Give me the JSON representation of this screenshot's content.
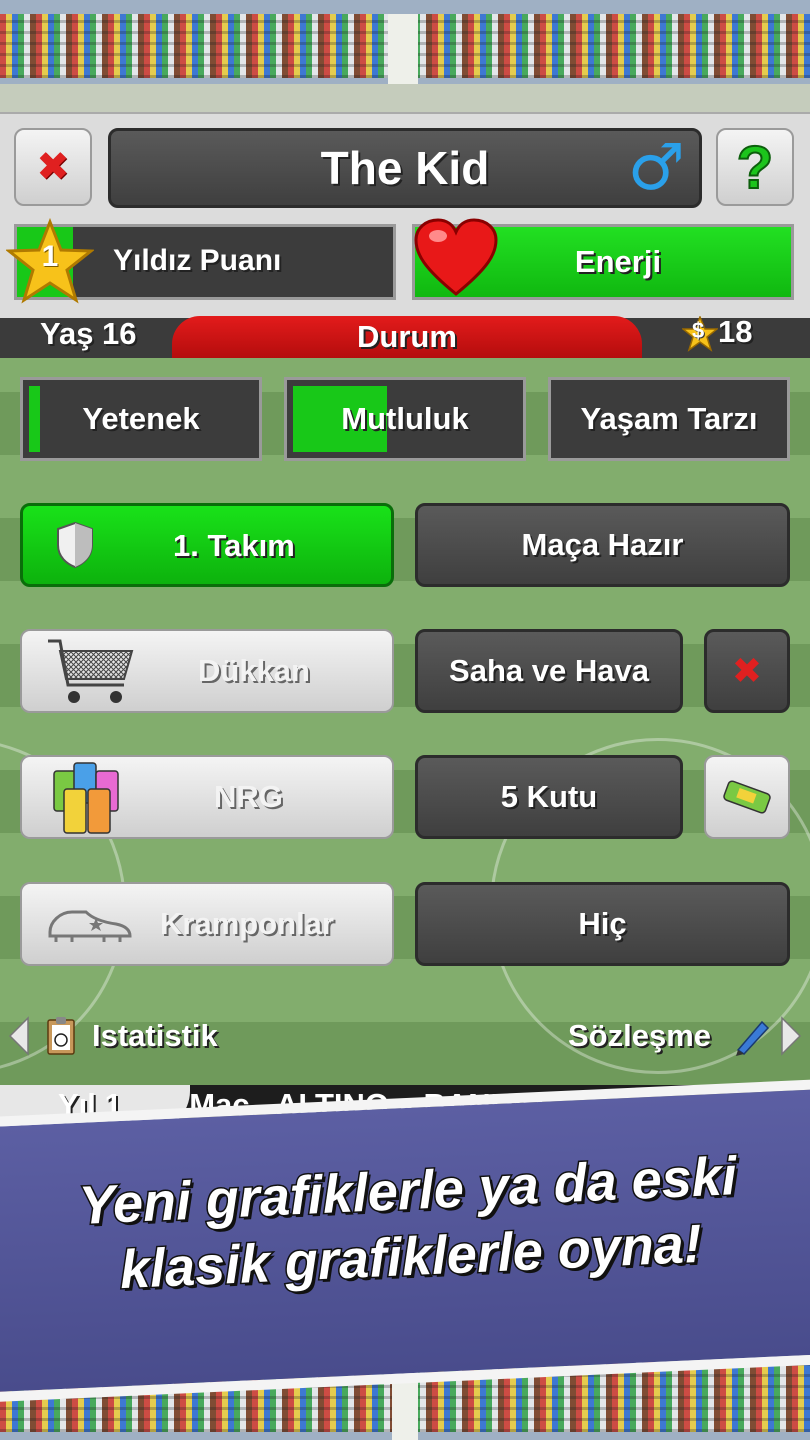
{
  "header": {
    "player_name": "The Kid",
    "gender_symbol": "♂",
    "help_label": "?",
    "close_symbol": "✖"
  },
  "stats": {
    "star_level": "1",
    "star_points_label": "Yıldız Puanı",
    "energy_label": "Enerji",
    "energy_level": 1.0,
    "age_label": "Yaş 16",
    "status_tab_label": "Durum",
    "money": "18",
    "money_symbol": "$"
  },
  "attributes": [
    {
      "label": "Yetenek",
      "level": 0.05
    },
    {
      "label": "Mutluluk",
      "level": 0.42
    },
    {
      "label": "Yaşam Tarzı",
      "level": 0
    }
  ],
  "rows": {
    "team_label": "1. Takım",
    "match_ready_label": "Maça Hazır",
    "shop_label": "Dükkan",
    "weather_label": "Saha ve Hava",
    "nrg_label": "NRG",
    "cans_label": "5 Kutu",
    "boots_label": "Kramponlar",
    "boots_value": "Hiç"
  },
  "nav": {
    "left_label": "Istatistik",
    "right_label": "Sözleşme"
  },
  "ticker": {
    "year_label": "Yıl 1",
    "news_text": "i Maç - ALTINO v BANDIR"
  },
  "banner": {
    "line1": "Yeni grafiklerle ya da eski",
    "line2": "klasik grafiklerle oyna!"
  },
  "colors": {
    "accent_green": "#19e219",
    "accent_red": "#e31b1b",
    "button_dark": "#4a4a4a",
    "banner_blue": "#5c5fa3"
  }
}
